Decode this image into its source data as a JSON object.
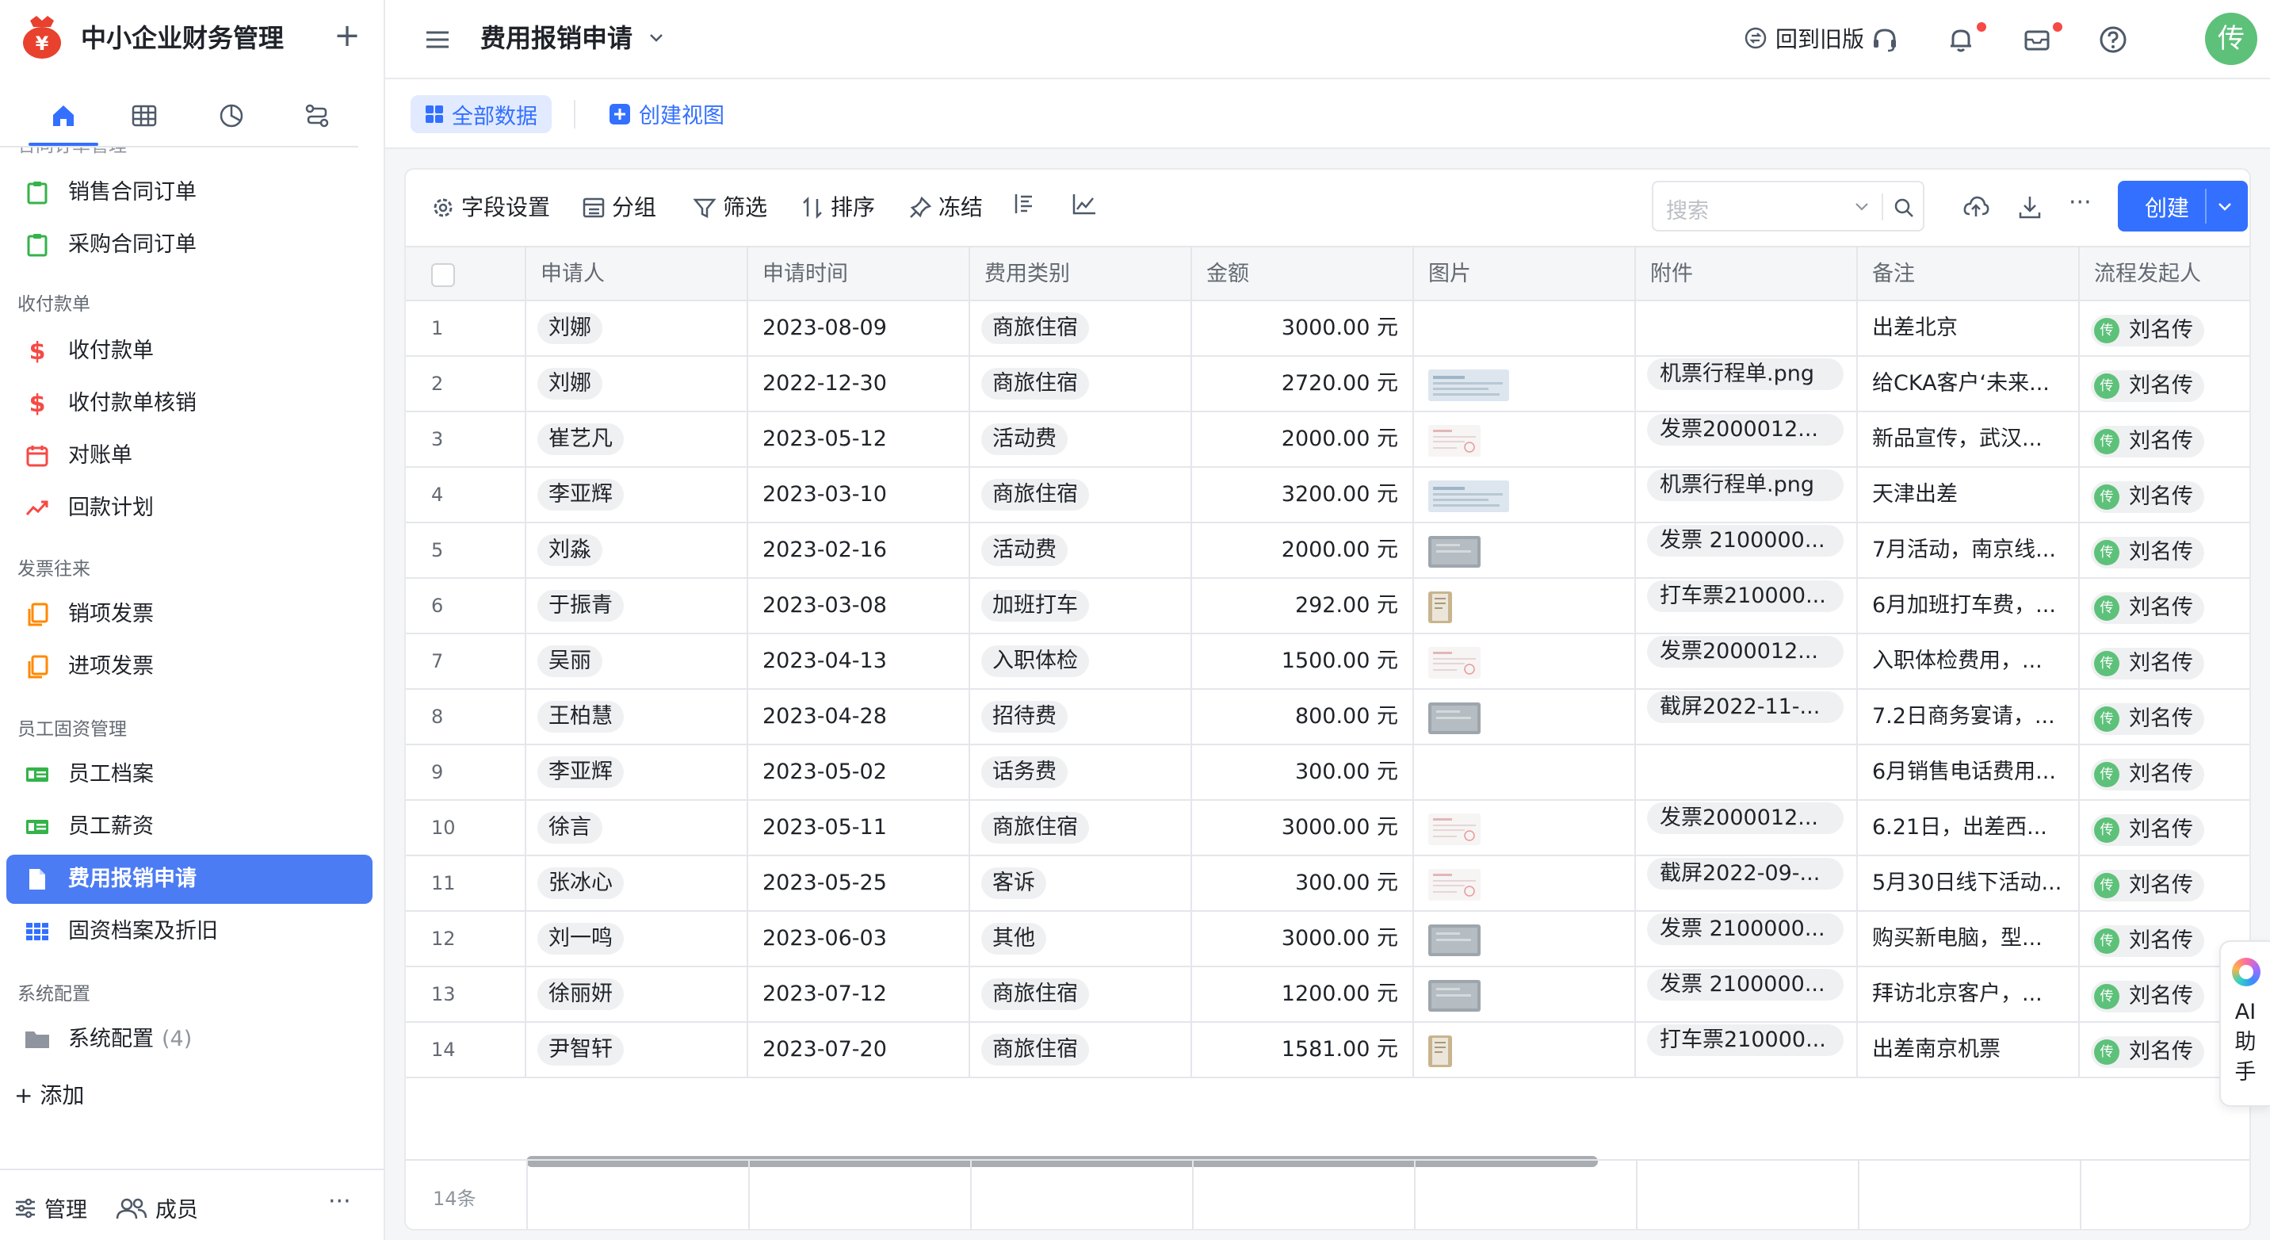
{
  "app": {
    "title": "中小企业财务管理"
  },
  "sidebar": {
    "partial_group": "合同订单管理",
    "groups": [
      {
        "label": "收付款单"
      },
      {
        "label": "发票往来"
      },
      {
        "label": "员工固资管理"
      },
      {
        "label": "系统配置"
      }
    ],
    "items": [
      {
        "label": "销售合同订单",
        "icon": "clipboard-icon"
      },
      {
        "label": "采购合同订单",
        "icon": "clipboard-icon"
      },
      {
        "label": "收付款单",
        "icon": "dollar-icon"
      },
      {
        "label": "收付款单核销",
        "icon": "dollar-icon"
      },
      {
        "label": "对账单",
        "icon": "calendar-icon"
      },
      {
        "label": "回款计划",
        "icon": "trend-icon"
      },
      {
        "label": "销项发票",
        "icon": "copy-icon"
      },
      {
        "label": "进项发票",
        "icon": "copy-icon"
      },
      {
        "label": "员工档案",
        "icon": "id-card-icon"
      },
      {
        "label": "员工薪资",
        "icon": "id-card-icon"
      },
      {
        "label": "费用报销申请",
        "icon": "document-icon",
        "active": true
      },
      {
        "label": "固资档案及折旧",
        "icon": "grid-icon"
      },
      {
        "label": "系统配置",
        "icon": "folder-icon",
        "count": "(4)"
      }
    ],
    "add_label": "+ 添加",
    "footer": {
      "manage": "管理",
      "members": "成员",
      "more": "···"
    }
  },
  "topbar": {
    "page_title": "费用报销申请",
    "back_old": "回到旧版",
    "avatar": "传"
  },
  "views": {
    "all": "全部数据",
    "create": "创建视图"
  },
  "toolbar": {
    "field_settings": "字段设置",
    "group": "分组",
    "filter": "筛选",
    "sort": "排序",
    "freeze": "冻结",
    "search_placeholder": "搜索",
    "more": "···",
    "create": "创建"
  },
  "table": {
    "columns": [
      "申请人",
      "申请时间",
      "费用类别",
      "金额",
      "图片",
      "附件",
      "备注",
      "流程发起人"
    ],
    "rows": [
      {
        "no": "1",
        "applicant": "刘娜",
        "date": "2023-08-09",
        "category": "商旅住宿",
        "amount": "3000.00 元",
        "image": "",
        "attachment": "",
        "note": "出差北京",
        "initiator": "刘名传",
        "initiator_avatar": "传"
      },
      {
        "no": "2",
        "applicant": "刘娜",
        "date": "2022-12-30",
        "category": "商旅住宿",
        "amount": "2720.00 元",
        "image": "wide",
        "attachment": "机票行程单.png",
        "note": "给CKA客户‘未来...",
        "initiator": "刘名传",
        "initiator_avatar": "传"
      },
      {
        "no": "3",
        "applicant": "崔艺凡",
        "date": "2023-05-12",
        "category": "活动费",
        "amount": "2000.00 元",
        "image": "invoice",
        "attachment": "发票2000012...",
        "note": "新品宣传，武汉...",
        "initiator": "刘名传",
        "initiator_avatar": "传"
      },
      {
        "no": "4",
        "applicant": "李亚辉",
        "date": "2023-03-10",
        "category": "商旅住宿",
        "amount": "3200.00 元",
        "image": "wide",
        "attachment": "机票行程单.png",
        "note": "天津出差",
        "initiator": "刘名传",
        "initiator_avatar": "传"
      },
      {
        "no": "5",
        "applicant": "刘淼",
        "date": "2023-02-16",
        "category": "活动费",
        "amount": "2000.00 元",
        "image": "gray",
        "attachment": "发票 2100000...",
        "note": "7月活动，南京线...",
        "initiator": "刘名传",
        "initiator_avatar": "传"
      },
      {
        "no": "6",
        "applicant": "于振青",
        "date": "2023-03-08",
        "category": "加班打车",
        "amount": "292.00 元",
        "image": "receipt",
        "attachment": "打车票210000...",
        "note": "6月加班打车费，...",
        "initiator": "刘名传",
        "initiator_avatar": "传"
      },
      {
        "no": "7",
        "applicant": "吴丽",
        "date": "2023-04-13",
        "category": "入职体检",
        "amount": "1500.00 元",
        "image": "invoice",
        "attachment": "发票2000012...",
        "note": "入职体检费用，...",
        "initiator": "刘名传",
        "initiator_avatar": "传"
      },
      {
        "no": "8",
        "applicant": "王柏慧",
        "date": "2023-04-28",
        "category": "招待费",
        "amount": "800.00 元",
        "image": "gray",
        "attachment": "截屏2022-11-...",
        "note": "7.2日商务宴请，...",
        "initiator": "刘名传",
        "initiator_avatar": "传"
      },
      {
        "no": "9",
        "applicant": "李亚辉",
        "date": "2023-05-02",
        "category": "话务费",
        "amount": "300.00 元",
        "image": "",
        "attachment": "",
        "note": "6月销售电话费用...",
        "initiator": "刘名传",
        "initiator_avatar": "传"
      },
      {
        "no": "10",
        "applicant": "徐言",
        "date": "2023-05-11",
        "category": "商旅住宿",
        "amount": "3000.00 元",
        "image": "invoice",
        "attachment": "发票2000012...",
        "note": "6.21日，出差西...",
        "initiator": "刘名传",
        "initiator_avatar": "传"
      },
      {
        "no": "11",
        "applicant": "张冰心",
        "date": "2023-05-25",
        "category": "客诉",
        "amount": "300.00 元",
        "image": "invoice",
        "attachment": "截屏2022-09-...",
        "note": "5月30日线下活动...",
        "initiator": "刘名传",
        "initiator_avatar": "传"
      },
      {
        "no": "12",
        "applicant": "刘一鸣",
        "date": "2023-06-03",
        "category": "其他",
        "amount": "3000.00 元",
        "image": "gray",
        "attachment": "发票 2100000...",
        "note": "购买新电脑，型...",
        "initiator": "刘名传",
        "initiator_avatar": "传"
      },
      {
        "no": "13",
        "applicant": "徐丽妍",
        "date": "2023-07-12",
        "category": "商旅住宿",
        "amount": "1200.00 元",
        "image": "gray",
        "attachment": "发票 2100000...",
        "note": "拜访北京客户，...",
        "initiator": "刘名传",
        "initiator_avatar": "传"
      },
      {
        "no": "14",
        "applicant": "尹智轩",
        "date": "2023-07-20",
        "category": "商旅住宿",
        "amount": "1581.00 元",
        "image": "receipt",
        "attachment": "打车票210000...",
        "note": "出差南京机票",
        "initiator": "刘名传",
        "initiator_avatar": "传"
      }
    ],
    "count_label": "14条"
  },
  "ai_assistant": {
    "label": "AI助手"
  },
  "colors": {
    "accent": "#3370ff",
    "active_nav": "#4c7cf3",
    "avatar": "#5dc17a",
    "logo": "#e8412e"
  }
}
